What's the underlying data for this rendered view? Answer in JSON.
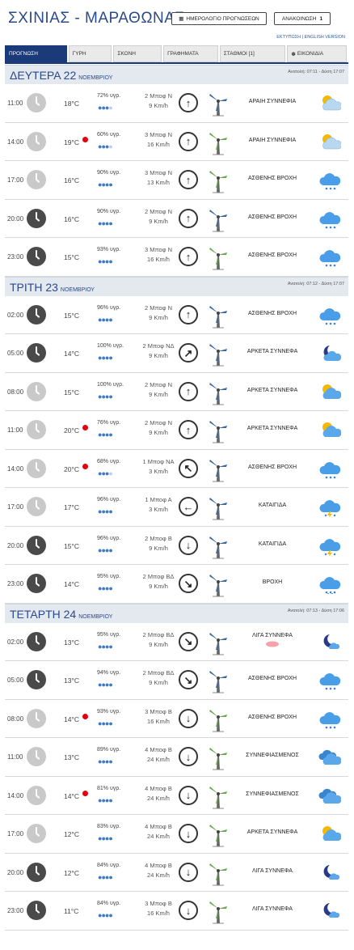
{
  "header": {
    "title": "ΣΧΙΝΙΑΣ - ΜΑΡΑΘΩΝΑΣ",
    "calendar_button": "ΗΜΕΡΟΛΟΓΙΟ ΠΡΟΓΝΩΣΕΩΝ",
    "announcements_button": "ΑΝΑΚΟΙΝΩΣΗ",
    "announcements_count": "1",
    "links": "ΕΚΤΥΠΩΣΗ | ENGLISH VERSION"
  },
  "tabs": [
    {
      "label": "ΠΡΟΓΝΩΣΗ",
      "active": true
    },
    {
      "label": "ΓΥΡΗ",
      "active": false
    },
    {
      "label": "ΣΚΟΝΗ",
      "active": false
    },
    {
      "label": "ΓΡΑΦΗΜΑΤΑ",
      "active": false
    },
    {
      "label": "ΣΤΑΘΜΟΙ [1]",
      "active": false
    },
    {
      "label": "ΕΙΚΟΝΙΔΙΑ",
      "active": false
    }
  ],
  "days": [
    {
      "name": "ΔΕΥΤΕΡΑ 22",
      "month": "ΝΟΕΜΒΡΙΟΥ",
      "sun": "Ανατολή: 07:11 - Δύση 17:07",
      "rows": [
        {
          "time": "11:00",
          "night": false,
          "temp": "18°C",
          "hot": false,
          "hum": "72% υγρ.",
          "drops": 3,
          "wind1": "2 Μποφ Ν",
          "wind2": "9 Km/h",
          "dir": "↑",
          "tcolor": "#3b6aa0",
          "cond": "ΑΡΑΙΗ ΣΥΝΝΕΦΙΑ",
          "icon": "sun-cloud"
        },
        {
          "time": "14:00",
          "night": false,
          "temp": "19°C",
          "hot": true,
          "hum": "60% υγρ.",
          "drops": 3,
          "wind1": "3 Μποφ Ν",
          "wind2": "16 Km/h",
          "dir": "↑",
          "tcolor": "#6aa84f",
          "cond": "ΑΡΑΙΗ ΣΥΝΝΕΦΙΑ",
          "icon": "sun-cloud"
        },
        {
          "time": "17:00",
          "night": false,
          "temp": "16°C",
          "hot": false,
          "hum": "90% υγρ.",
          "drops": 4,
          "wind1": "3 Μποφ Ν",
          "wind2": "13 Km/h",
          "dir": "↑",
          "tcolor": "#6aa84f",
          "cond": "ΑΣΘΕΝΗΣ ΒΡΟΧΗ",
          "icon": "rain"
        },
        {
          "time": "20:00",
          "night": true,
          "temp": "16°C",
          "hot": false,
          "hum": "90% υγρ.",
          "drops": 4,
          "wind1": "2 Μποφ Ν",
          "wind2": "9 Km/h",
          "dir": "↑",
          "tcolor": "#3b6aa0",
          "cond": "ΑΣΘΕΝΗΣ ΒΡΟΧΗ",
          "icon": "rain"
        },
        {
          "time": "23:00",
          "night": true,
          "temp": "15°C",
          "hot": false,
          "hum": "93% υγρ.",
          "drops": 4,
          "wind1": "3 Μποφ Ν",
          "wind2": "16 Km/h",
          "dir": "↑",
          "tcolor": "#6aa84f",
          "cond": "ΑΣΘΕΝΗΣ ΒΡΟΧΗ",
          "icon": "rain"
        }
      ]
    },
    {
      "name": "ΤΡΙΤΗ 23",
      "month": "ΝΟΕΜΒΡΙΟΥ",
      "sun": "Ανατολή: 07:12 - Δύση 17:07",
      "rows": [
        {
          "time": "02:00",
          "night": true,
          "temp": "15°C",
          "hot": false,
          "hum": "96% υγρ.",
          "drops": 4,
          "wind1": "2 Μποφ Ν",
          "wind2": "9 Km/h",
          "dir": "↑",
          "tcolor": "#3b6aa0",
          "cond": "ΑΣΘΕΝΗΣ ΒΡΟΧΗ",
          "icon": "rain"
        },
        {
          "time": "05:00",
          "night": true,
          "temp": "14°C",
          "hot": false,
          "hum": "100% υγρ.",
          "drops": 4,
          "wind1": "2 Μποφ ΝΔ",
          "wind2": "9 Km/h",
          "dir": "↗",
          "tcolor": "#3b6aa0",
          "cond": "ΑΡΚΕΤΑ ΣΥΝΝΕΦΑ",
          "icon": "moon-cloud"
        },
        {
          "time": "08:00",
          "night": false,
          "temp": "15°C",
          "hot": false,
          "hum": "100% υγρ.",
          "drops": 4,
          "wind1": "2 Μποφ Ν",
          "wind2": "9 Km/h",
          "dir": "↑",
          "tcolor": "#3b6aa0",
          "cond": "ΑΡΚΕΤΑ ΣΥΝΝΕΦΑ",
          "icon": "sun-cloud2"
        },
        {
          "time": "11:00",
          "night": false,
          "temp": "20°C",
          "hot": true,
          "hum": "76% υγρ.",
          "drops": 4,
          "wind1": "2 Μποφ Ν",
          "wind2": "9 Km/h",
          "dir": "↑",
          "tcolor": "#3b6aa0",
          "cond": "ΑΡΚΕΤΑ ΣΥΝΝΕΦΑ",
          "icon": "sun-cloud2"
        },
        {
          "time": "14:00",
          "night": false,
          "temp": "20°C",
          "hot": true,
          "hum": "68% υγρ.",
          "drops": 3,
          "wind1": "1 Μποφ ΝΑ",
          "wind2": "3 Km/h",
          "dir": "↖",
          "tcolor": "#3b6aa0",
          "cond": "ΑΣΘΕΝΗΣ ΒΡΟΧΗ",
          "icon": "rain"
        },
        {
          "time": "17:00",
          "night": false,
          "temp": "17°C",
          "hot": false,
          "hum": "96% υγρ.",
          "drops": 4,
          "wind1": "1 Μποφ Α",
          "wind2": "3 Km/h",
          "dir": "←",
          "tcolor": "#3b6aa0",
          "cond": "ΚΑΤΑΙΓΙΔΑ",
          "icon": "storm"
        },
        {
          "time": "20:00",
          "night": true,
          "temp": "15°C",
          "hot": false,
          "hum": "96% υγρ.",
          "drops": 4,
          "wind1": "2 Μποφ Β",
          "wind2": "9 Km/h",
          "dir": "↓",
          "tcolor": "#3b6aa0",
          "cond": "ΚΑΤΑΙΓΙΔΑ",
          "icon": "storm"
        },
        {
          "time": "23:00",
          "night": true,
          "temp": "14°C",
          "hot": false,
          "hum": "95% υγρ.",
          "drops": 4,
          "wind1": "2 Μποφ ΒΔ",
          "wind2": "9 Km/h",
          "dir": "↘",
          "tcolor": "#3b6aa0",
          "cond": "ΒΡΟΧΗ",
          "icon": "heavy-rain"
        }
      ]
    },
    {
      "name": "ΤΕΤΑΡΤΗ 24",
      "month": "ΝΟΕΜΒΡΙΟΥ",
      "sun": "Ανατολή: 07:13 - Δύση 17:06",
      "rows": [
        {
          "time": "02:00",
          "night": true,
          "temp": "13°C",
          "hot": false,
          "hum": "95% υγρ.",
          "drops": 4,
          "wind1": "2 Μποφ ΒΔ",
          "wind2": "9 Km/h",
          "dir": "↘",
          "tcolor": "#3b6aa0",
          "cond": "ΛΙΓΑ ΣΥΝΝΕΦΑ",
          "extra": true,
          "icon": "moon-small"
        },
        {
          "time": "05:00",
          "night": true,
          "temp": "13°C",
          "hot": false,
          "hum": "94% υγρ.",
          "drops": 4,
          "wind1": "2 Μποφ ΒΔ",
          "wind2": "9 Km/h",
          "dir": "↘",
          "tcolor": "#3b6aa0",
          "cond": "ΑΣΘΕΝΗΣ ΒΡΟΧΗ",
          "icon": "rain"
        },
        {
          "time": "08:00",
          "night": false,
          "temp": "14°C",
          "hot": true,
          "hum": "93% υγρ.",
          "drops": 4,
          "wind1": "3 Μποφ Β",
          "wind2": "16 Km/h",
          "dir": "↓",
          "tcolor": "#6aa84f",
          "cond": "ΑΣΘΕΝΗΣ ΒΡΟΧΗ",
          "icon": "rain"
        },
        {
          "time": "11:00",
          "night": false,
          "temp": "13°C",
          "hot": false,
          "hum": "89% υγρ.",
          "drops": 4,
          "wind1": "4 Μποφ Β",
          "wind2": "24 Km/h",
          "dir": "↓",
          "tcolor": "#6aa84f",
          "cond": "ΣΥΝΝΕΦΙΑΣΜΕΝΟΣ",
          "icon": "clouds"
        },
        {
          "time": "14:00",
          "night": false,
          "temp": "14°C",
          "hot": true,
          "hum": "81% υγρ.",
          "drops": 4,
          "wind1": "4 Μποφ Β",
          "wind2": "24 Km/h",
          "dir": "↓",
          "tcolor": "#6aa84f",
          "cond": "ΣΥΝΝΕΦΙΑΣΜΕΝΟΣ",
          "icon": "clouds"
        },
        {
          "time": "17:00",
          "night": false,
          "temp": "12°C",
          "hot": false,
          "hum": "83% υγρ.",
          "drops": 4,
          "wind1": "4 Μποφ Β",
          "wind2": "24 Km/h",
          "dir": "↓",
          "tcolor": "#6aa84f",
          "cond": "ΑΡΚΕΤΑ ΣΥΝΝΕΦΑ",
          "icon": "sun-cloud2"
        },
        {
          "time": "20:00",
          "night": true,
          "temp": "12°C",
          "hot": false,
          "hum": "84% υγρ.",
          "drops": 4,
          "wind1": "4 Μποφ Β",
          "wind2": "24 Km/h",
          "dir": "↓",
          "tcolor": "#6aa84f",
          "cond": "ΛΙΓΑ ΣΥΝΝΕΦΑ",
          "icon": "moon-small"
        },
        {
          "time": "23:00",
          "night": true,
          "temp": "11°C",
          "hot": false,
          "hum": "84% υγρ.",
          "drops": 4,
          "wind1": "3 Μποφ Β",
          "wind2": "16 Km/h",
          "dir": "↓",
          "tcolor": "#6aa84f",
          "cond": "ΛΙΓΑ ΣΥΝΝΕΦΑ",
          "icon": "moon-small"
        }
      ]
    }
  ]
}
